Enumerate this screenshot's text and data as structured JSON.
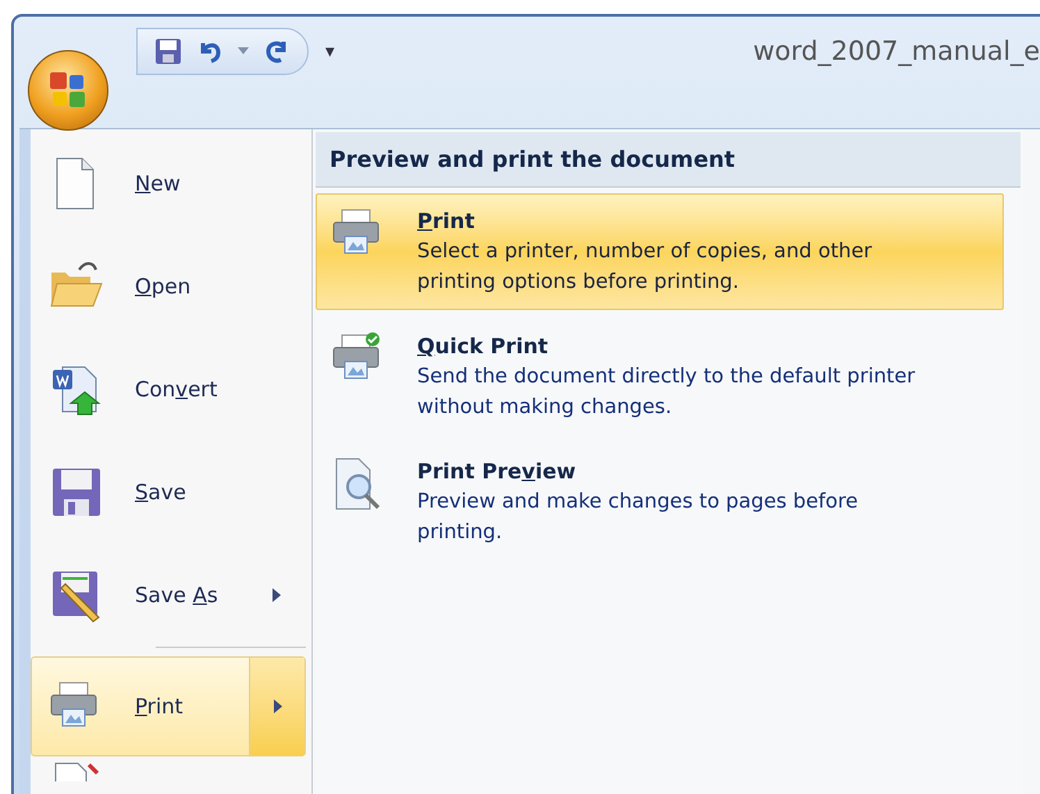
{
  "window": {
    "title": "word_2007_manual_e"
  },
  "quick_access": {
    "customize": "▾"
  },
  "menu": {
    "items": [
      {
        "kind": "new",
        "label_parts": {
          "key": "N",
          "after": "ew"
        },
        "selected": false,
        "submenu": false
      },
      {
        "kind": "open",
        "label_parts": {
          "key": "O",
          "after": "pen"
        },
        "selected": false,
        "submenu": false
      },
      {
        "kind": "convert",
        "label_parts": {
          "before": "Con",
          "key": "v",
          "after": "ert"
        },
        "selected": false,
        "submenu": false
      },
      {
        "kind": "save",
        "label_parts": {
          "key": "S",
          "after": "ave"
        },
        "selected": false,
        "submenu": false
      },
      {
        "kind": "saveas",
        "label_parts": {
          "before": "Save ",
          "key": "A",
          "after": "s"
        },
        "selected": false,
        "submenu": true
      },
      {
        "kind": "print",
        "label_parts": {
          "key": "P",
          "after": "rint"
        },
        "selected": true,
        "submenu": true
      }
    ]
  },
  "submenu": {
    "heading": "Preview and print the document",
    "items": [
      {
        "kind": "print",
        "title_parts": {
          "key": "P",
          "after": "rint"
        },
        "description": "Select a printer, number of copies, and other printing options before printing.",
        "selected": true
      },
      {
        "kind": "quick",
        "title_parts": {
          "key": "Q",
          "after": "uick Print"
        },
        "description": "Send the document directly to the default printer without making changes.",
        "selected": false
      },
      {
        "kind": "preview",
        "title_parts": {
          "before": "Print Pre",
          "key": "v",
          "after": "iew"
        },
        "description": "Preview and make changes to pages before printing.",
        "selected": false
      }
    ]
  }
}
